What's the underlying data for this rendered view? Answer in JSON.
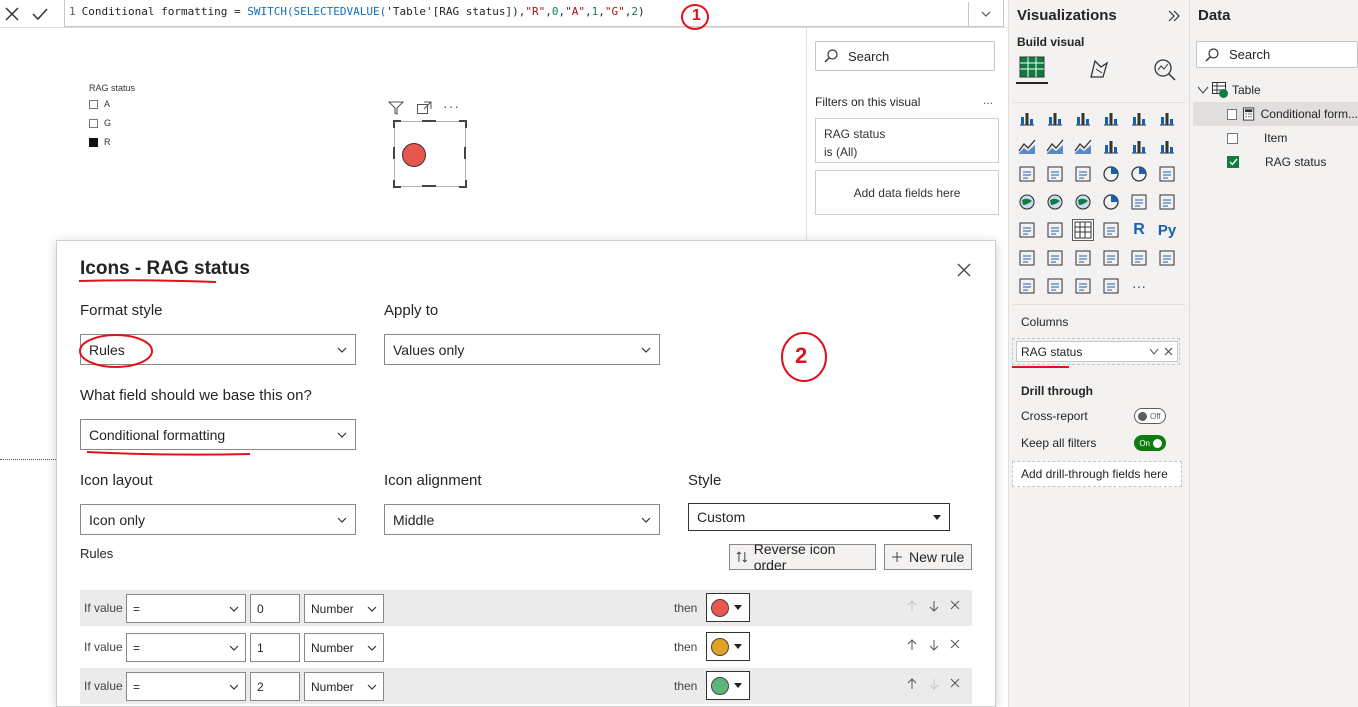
{
  "formula_bar": {
    "line_number": "1",
    "measure_name": "Conditional formatting = ",
    "func": "SWITCH(SELECTEDVALUE(",
    "column_ref": "'Table'[RAG status]",
    "close1": "),",
    "s_r": "\"R\"",
    "comma1": ",",
    "n0": "0",
    "comma2": ",",
    "s_a": "\"A\"",
    "comma3": ",",
    "n1": "1",
    "comma4": ",",
    "s_g": "\"G\"",
    "comma5": ",",
    "n2": "2",
    "close2": ")"
  },
  "slicer": {
    "title": "RAG status",
    "items": [
      {
        "label": "A",
        "checked": false
      },
      {
        "label": "G",
        "checked": false
      },
      {
        "label": "R",
        "checked": true
      }
    ]
  },
  "filters_pane": {
    "search_placeholder": "Search",
    "section_title": "Filters on this visual",
    "more": "...",
    "filter_field": "RAG status",
    "filter_value": "is (All)",
    "add_fields": "Add data fields here"
  },
  "visualizations": {
    "title": "Visualizations",
    "build_visual": "Build visual",
    "columns_label": "Columns",
    "column_field": "RAG status",
    "drill_through": "Drill through",
    "cross_report": "Cross-report",
    "cross_report_state": "Off",
    "keep_filters": "Keep all filters",
    "keep_filters_state": "On",
    "add_drill": "Add drill-through fields here",
    "r_label": "R",
    "py_label": "Py",
    "more": "···"
  },
  "data_pane": {
    "title": "Data",
    "search_placeholder": "Search",
    "table_name": "Table",
    "fields": [
      {
        "label": "Conditional form...",
        "checked": false
      },
      {
        "label": "Item",
        "checked": false
      },
      {
        "label": "RAG status",
        "checked": true
      }
    ]
  },
  "dialog": {
    "title": "Icons - RAG status",
    "format_style_label": "Format style",
    "format_style_value": "Rules",
    "apply_to_label": "Apply to",
    "apply_to_value": "Values only",
    "base_field_label": "What field should we base this on?",
    "base_field_value": "Conditional formatting",
    "icon_layout_label": "Icon layout",
    "icon_layout_value": "Icon only",
    "icon_alignment_label": "Icon alignment",
    "icon_alignment_value": "Middle",
    "style_label": "Style",
    "style_value": "Custom",
    "rules_label": "Rules",
    "reverse_btn": "Reverse icon order",
    "new_rule_btn": "New rule",
    "rules": [
      {
        "if": "If value",
        "op": "=",
        "value": "0",
        "type": "Number",
        "then": "then",
        "color": "#e8574e"
      },
      {
        "if": "If value",
        "op": "=",
        "value": "1",
        "type": "Number",
        "then": "then",
        "color": "#e0a326"
      },
      {
        "if": "If value",
        "op": "=",
        "value": "2",
        "type": "Number",
        "then": "then",
        "color": "#5cb87a"
      }
    ]
  },
  "annotations": {
    "one": "1",
    "two": "2",
    "color": "#e0121c"
  }
}
